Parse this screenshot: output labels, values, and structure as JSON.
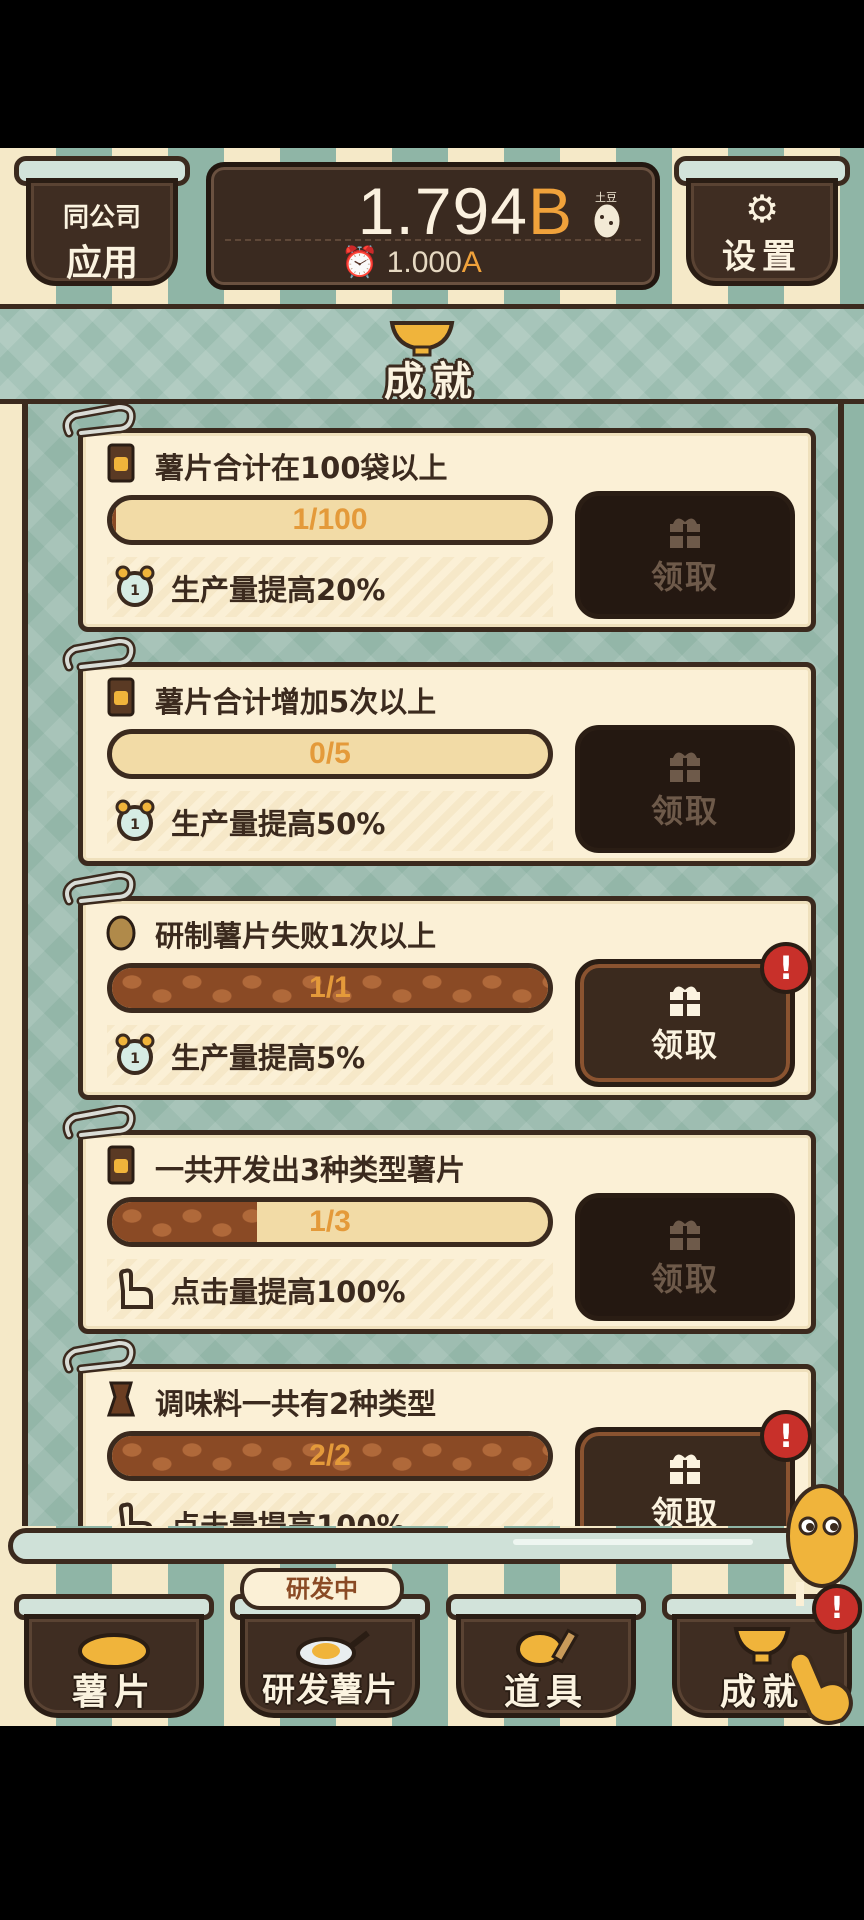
{
  "topbar": {
    "left_button": {
      "line1": "同公司",
      "line2": "应用"
    },
    "counter": {
      "amount": "1.794",
      "amount_unit": "B",
      "currency_label": "土豆",
      "rate": "1.000",
      "rate_unit": "A"
    },
    "settings_label": "设置"
  },
  "header": {
    "title": "成就"
  },
  "achievements": [
    {
      "title": "薯片合计在100袋以上",
      "progress_text": "1/100",
      "progress": 0.01,
      "reward": "生产量提高20%",
      "reward_icon": "alarm-clock-icon",
      "title_icon": "chip-bag-icon",
      "claim_label": "领取",
      "claimable": false
    },
    {
      "title": "薯片合计增加5次以上",
      "progress_text": "0/5",
      "progress": 0.0,
      "reward": "生产量提高50%",
      "reward_icon": "alarm-clock-icon",
      "title_icon": "chip-bag-icon",
      "claim_label": "领取",
      "claimable": false
    },
    {
      "title": "研制薯片失败1次以上",
      "progress_text": "1/1",
      "progress": 1.0,
      "reward": "生产量提高5%",
      "reward_icon": "alarm-clock-icon",
      "title_icon": "potato-icon",
      "claim_label": "领取",
      "claimable": true
    },
    {
      "title": "一共开发出3种类型薯片",
      "progress_text": "1/3",
      "progress": 0.333,
      "reward": "点击量提高100%",
      "reward_icon": "tap-hand-icon",
      "title_icon": "chip-bag-icon",
      "claim_label": "领取",
      "claimable": false
    },
    {
      "title": "调味料一共有2种类型",
      "progress_text": "2/2",
      "progress": 1.0,
      "reward": "点击量提高100%",
      "reward_icon": "tap-hand-icon",
      "title_icon": "seasoning-icon",
      "claim_label": "领取",
      "claimable": true
    }
  ],
  "alert_mark": "!",
  "nav": {
    "chips": "薯片",
    "research": "研发薯片",
    "research_badge": "研发中",
    "items": "道具",
    "achievements": "成就"
  },
  "colors": {
    "dark_brown": "#3b2a1e",
    "cream": "#fbf0d6",
    "mint": "#93b6a8",
    "orange": "#f0a23b",
    "alert_red": "#c8302a"
  }
}
